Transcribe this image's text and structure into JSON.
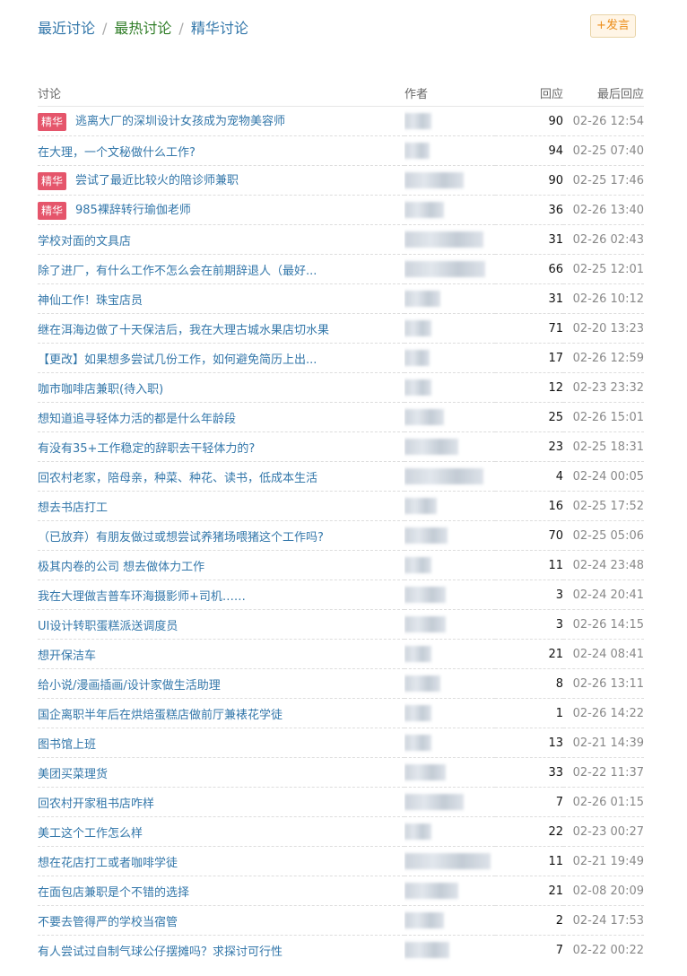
{
  "nav": {
    "recent": "最近讨论",
    "hot": "最热讨论",
    "featured": "精华讨论",
    "separator": "/",
    "post_label": "+发言"
  },
  "colors": {
    "link": "#3377aa",
    "active_nav": "#2f7d27",
    "badge": "#e5556b",
    "post_text": "#ec8d18"
  },
  "table": {
    "headers": {
      "title": "讨论",
      "author": "作者",
      "replies": "回应",
      "last_reply": "最后回应"
    },
    "badge_label": "精华",
    "rows": [
      {
        "title": "逃离大厂的深圳设计女孩成为宠物美容师",
        "featured": true,
        "replies": "90",
        "time": "02-26 12:54"
      },
      {
        "title": "在大理，一个文秘做什么工作?",
        "featured": false,
        "replies": "94",
        "time": "02-25 07:40"
      },
      {
        "title": "尝试了最近比较火的陪诊师兼职",
        "featured": true,
        "replies": "90",
        "time": "02-25 17:46"
      },
      {
        "title": "985裸辞转行瑜伽老师",
        "featured": true,
        "replies": "36",
        "time": "02-26 13:40"
      },
      {
        "title": "学校对面的文具店",
        "featured": false,
        "replies": "31",
        "time": "02-26 02:43"
      },
      {
        "title": "除了进厂，有什么工作不怎么会在前期辞退人（最好...",
        "featured": false,
        "replies": "66",
        "time": "02-25 12:01"
      },
      {
        "title": "神仙工作！珠宝店员",
        "featured": false,
        "replies": "31",
        "time": "02-26 10:12"
      },
      {
        "title": "继在洱海边做了十天保洁后，我在大理古城水果店切水果",
        "featured": false,
        "replies": "71",
        "time": "02-20 13:23"
      },
      {
        "title": "【更改】如果想多尝试几份工作，如何避免简历上出...",
        "featured": false,
        "replies": "17",
        "time": "02-26 12:59"
      },
      {
        "title": "咖市咖啡店兼职(待入职)",
        "featured": false,
        "replies": "12",
        "time": "02-23 23:32"
      },
      {
        "title": "想知道追寻轻体力活的都是什么年龄段",
        "featured": false,
        "replies": "25",
        "time": "02-26 15:01"
      },
      {
        "title": "有没有35+工作稳定的辞职去干轻体力的?",
        "featured": false,
        "replies": "23",
        "time": "02-25 18:31"
      },
      {
        "title": "回农村老家，陪母亲，种菜、种花、读书，低成本生活",
        "featured": false,
        "replies": "4",
        "time": "02-24 00:05"
      },
      {
        "title": "想去书店打工",
        "featured": false,
        "replies": "16",
        "time": "02-25 17:52"
      },
      {
        "title": "（已放弃）有朋友做过或想尝试养猪场喂猪这个工作吗?",
        "featured": false,
        "replies": "70",
        "time": "02-25 05:06"
      },
      {
        "title": "极其内卷的公司 想去做体力工作",
        "featured": false,
        "replies": "11",
        "time": "02-24 23:48"
      },
      {
        "title": "我在大理做吉普车环海摄影师+司机……",
        "featured": false,
        "replies": "3",
        "time": "02-24 20:41"
      },
      {
        "title": "UI设计转职蛋糕派送调度员",
        "featured": false,
        "replies": "3",
        "time": "02-26 14:15"
      },
      {
        "title": "想开保洁车",
        "featured": false,
        "replies": "21",
        "time": "02-24 08:41"
      },
      {
        "title": "给小说/漫画插画/设计家做生活助理",
        "featured": false,
        "replies": "8",
        "time": "02-26 13:11"
      },
      {
        "title": "国企离职半年后在烘焙蛋糕店做前厅兼裱花学徒",
        "featured": false,
        "replies": "1",
        "time": "02-26 14:22"
      },
      {
        "title": "图书馆上班",
        "featured": false,
        "replies": "13",
        "time": "02-21 14:39"
      },
      {
        "title": "美团买菜理货",
        "featured": false,
        "replies": "33",
        "time": "02-22 11:37"
      },
      {
        "title": "回农村开家租书店咋样",
        "featured": false,
        "replies": "7",
        "time": "02-26 01:15"
      },
      {
        "title": "美工这个工作怎么样",
        "featured": false,
        "replies": "22",
        "time": "02-23 00:27"
      },
      {
        "title": "想在花店打工或者咖啡学徒",
        "featured": false,
        "replies": "11",
        "time": "02-21 19:49"
      },
      {
        "title": "在面包店兼职是个不错的选择",
        "featured": false,
        "replies": "21",
        "time": "02-08 20:09"
      },
      {
        "title": "不要去管得严的学校当宿管",
        "featured": false,
        "replies": "2",
        "time": "02-24 17:53"
      },
      {
        "title": "有人尝试过自制气球公仔摆摊吗？求探讨可行性",
        "featured": false,
        "replies": "7",
        "time": "02-22 00:22"
      }
    ]
  }
}
